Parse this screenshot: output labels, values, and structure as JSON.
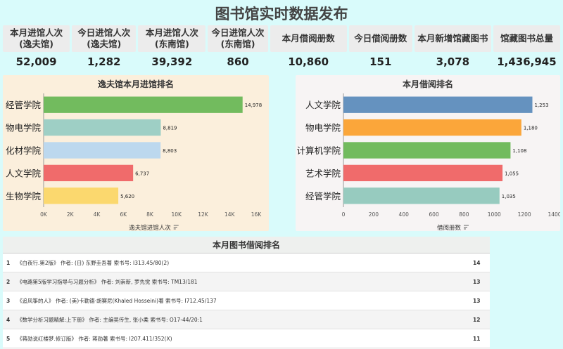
{
  "page": {
    "title": "图书馆实时数据发布"
  },
  "kpis": [
    {
      "label": "本月进馆人次\n(逸夫馆)",
      "value": "52,009"
    },
    {
      "label": "今日进馆人次\n(逸夫馆)",
      "value": "1,282"
    },
    {
      "label": "本月进馆人次\n(东南馆)",
      "value": "39,392"
    },
    {
      "label": "今日进馆人次\n(东南馆)",
      "value": "860"
    },
    {
      "label": "本月借阅册数",
      "value": "10,860"
    },
    {
      "label": "今日借阅册数",
      "value": "151"
    },
    {
      "label": "本月新增馆藏图书",
      "value": "3,078"
    },
    {
      "label": "馆藏图书总量",
      "value": "1,436,945"
    }
  ],
  "chart_data": [
    {
      "type": "bar",
      "orientation": "horizontal",
      "title": "逸夫馆本月进馆排名",
      "xlabel": "逸夫馆进馆人次",
      "ylabel": "",
      "xlim": [
        0,
        16000
      ],
      "ticks": [
        "0K",
        "2K",
        "4K",
        "6K",
        "8K",
        "10K",
        "12K",
        "14K",
        "16K"
      ],
      "categories": [
        "经管学院",
        "物电学院",
        "化材学院",
        "人文学院",
        "生物学院"
      ],
      "values": [
        14978,
        8819,
        8803,
        6737,
        5620
      ],
      "value_labels": [
        "14,978",
        "8,819",
        "8,803",
        "6,737",
        "5,620"
      ],
      "colors": [
        "#72bb5e",
        "#9ecfc5",
        "#bcd8ee",
        "#f06b6b",
        "#fbd86e"
      ]
    },
    {
      "type": "bar",
      "orientation": "horizontal",
      "title": "本月借阅排名",
      "xlabel": "借阅册数",
      "ylabel": "",
      "xlim": [
        0,
        1400
      ],
      "ticks": [
        "0",
        "200",
        "400",
        "600",
        "800",
        "1000",
        "1200",
        "1400"
      ],
      "categories": [
        "人文学院",
        "物电学院",
        "计算机学院",
        "艺术学院",
        "经管学院"
      ],
      "values": [
        1253,
        1180,
        1108,
        1055,
        1035
      ],
      "value_labels": [
        "1,253",
        "1,180",
        "1,108",
        "1,055",
        "1,035"
      ],
      "colors": [
        "#6592bf",
        "#fba63a",
        "#72bb5e",
        "#f06b6b",
        "#97cbbf"
      ]
    }
  ],
  "book_list": {
    "title": "本月图书借阅排名",
    "rows": [
      {
        "rank": "1",
        "text": "《白夜行.第2版》  作者: (日) 东野圭吾著  索书号: I313.45/80(2)",
        "count": "14"
      },
      {
        "rank": "2",
        "text": "《电路第5版学习指导与习题分析》  作者: 刘崇新, 罗先觉  索书号: TM13/181",
        "count": "13"
      },
      {
        "rank": "3",
        "text": "《追风筝的人》  作者: (美)卡勒德·胡赛尼(Khaled Hosseini)著  索书号: I712.45/137",
        "count": "13"
      },
      {
        "rank": "4",
        "text": "《数学分析习题精解:上下册》  作者: 主编吴传生, 张小柔  索书号: O17-44/20:1",
        "count": "12"
      },
      {
        "rank": "5",
        "text": "《蒋勋说红楼梦.修订版》  作者: 蒋勋著  索书号: I207.411/352(X)",
        "count": "11"
      }
    ]
  }
}
